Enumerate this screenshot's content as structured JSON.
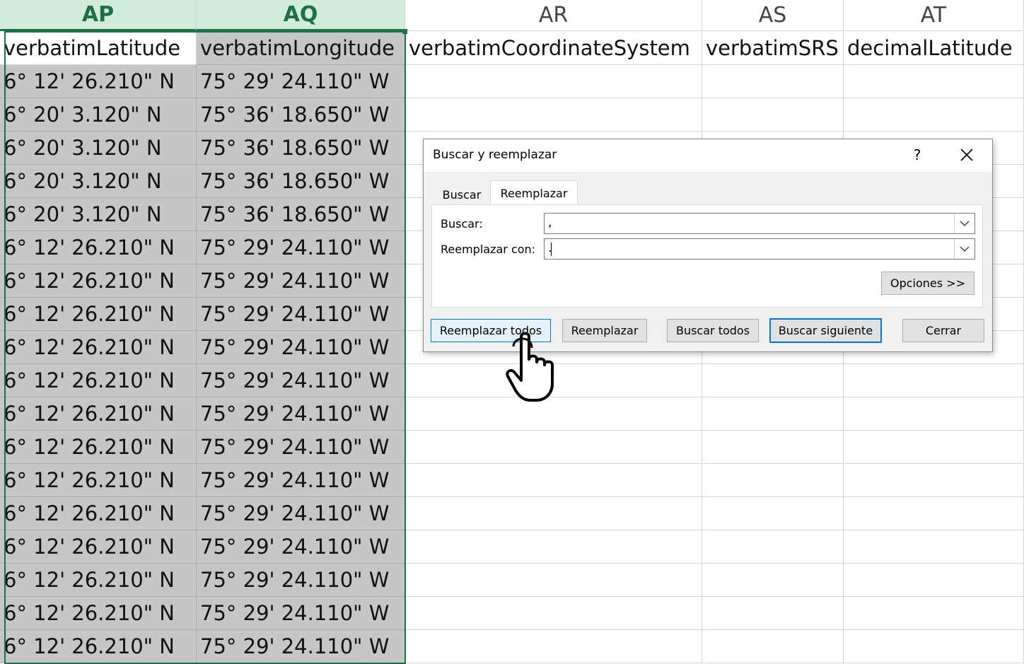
{
  "sheet": {
    "columns": [
      {
        "letter": "AP",
        "header": "verbatimLatitude",
        "selected": true
      },
      {
        "letter": "AQ",
        "header": "verbatimLongitude",
        "selected": true
      },
      {
        "letter": "AR",
        "header": "verbatimCoordinateSystem",
        "selected": false
      },
      {
        "letter": "AS",
        "header": "verbatimSRS",
        "selected": false
      },
      {
        "letter": "AT",
        "header": "decimalLatitude",
        "selected": false
      }
    ],
    "rows": [
      [
        "6° 12' 26.210\" N",
        "75° 29' 24.110\" W"
      ],
      [
        "6° 20' 3.120\" N",
        "75° 36' 18.650\" W"
      ],
      [
        "6° 20' 3.120\" N",
        "75° 36' 18.650\" W"
      ],
      [
        "6° 20' 3.120\" N",
        "75° 36' 18.650\" W"
      ],
      [
        "6° 20' 3.120\" N",
        "75° 36' 18.650\" W"
      ],
      [
        "6° 12' 26.210\" N",
        "75° 29' 24.110\" W"
      ],
      [
        "6° 12' 26.210\" N",
        "75° 29' 24.110\" W"
      ],
      [
        "6° 12' 26.210\" N",
        "75° 29' 24.110\" W"
      ],
      [
        "6° 12' 26.210\" N",
        "75° 29' 24.110\" W"
      ],
      [
        "6° 12' 26.210\" N",
        "75° 29' 24.110\" W"
      ],
      [
        "6° 12' 26.210\" N",
        "75° 29' 24.110\" W"
      ],
      [
        "6° 12' 26.210\" N",
        "75° 29' 24.110\" W"
      ],
      [
        "6° 12' 26.210\" N",
        "75° 29' 24.110\" W"
      ],
      [
        "6° 12' 26.210\" N",
        "75° 29' 24.110\" W"
      ],
      [
        "6° 12' 26.210\" N",
        "75° 29' 24.110\" W"
      ],
      [
        "6° 12' 26.210\" N",
        "75° 29' 24.110\" W"
      ],
      [
        "6° 12' 26.210\" N",
        "75° 29' 24.110\" W"
      ],
      [
        "6° 12' 26.210\" N",
        "75° 29' 24.110\" W"
      ]
    ]
  },
  "dialog": {
    "title": "Buscar y reemplazar",
    "help": "?",
    "tabs": {
      "find": "Buscar",
      "replace": "Reemplazar"
    },
    "find_label": "Buscar:",
    "find_value": ",",
    "replace_label": "Reemplazar con:",
    "replace_value": ".",
    "options_button": "Opciones >>",
    "buttons": {
      "replace_all": "Reemplazar todos",
      "replace": "Reemplazar",
      "find_all": "Buscar todos",
      "find_next": "Buscar siguiente",
      "close": "Cerrar"
    }
  },
  "colors": {
    "selection_green": "#1e7145",
    "header_selected_bg": "#d2ecdc",
    "selected_cell_bg": "#c6c6c6",
    "dialog_accent": "#0078d7"
  },
  "cursor": {
    "icon": "hand-pointer-icon"
  }
}
